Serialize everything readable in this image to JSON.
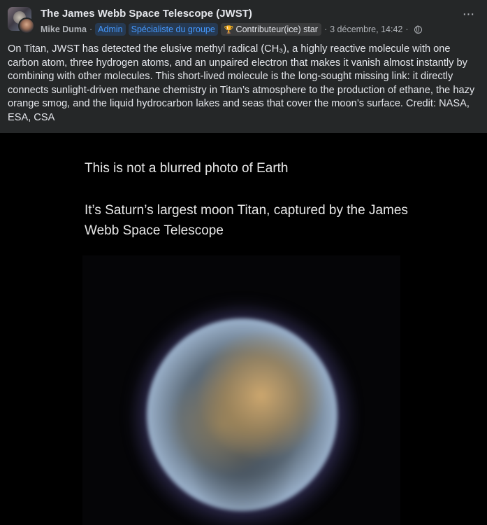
{
  "header": {
    "group_name": "The James Webb Space Telescope (JWST)",
    "author": "Mike Duma",
    "separator": "·",
    "badges": [
      "Admin",
      "Spécialiste du groupe"
    ],
    "contributor_badge": "Contributeur(ice) star",
    "trophy_icon": "🏆",
    "timestamp": "3 décembre, 14:42",
    "visibility_icon": "globe-icon",
    "more_label": "···"
  },
  "post": {
    "text": "On Titan, JWST has detected the elusive methyl radical (CH₃), a highly reactive molecule with one carbon atom, three hydrogen atoms, and an unpaired electron that makes it vanish almost instantly by combining with other molecules. This short-lived molecule is the long-sought missing link: it directly connects sunlight-driven methane chemistry in Titan’s atmosphere to the production of ethane, the hazy orange smog, and the liquid hydrocarbon lakes and seas that cover the moon’s surface. Credit: NASA, ESA, CSA"
  },
  "image": {
    "line1": "This is not a blurred photo of Earth",
    "line2": "It’s Saturn’s largest moon Titan, captured by the James Webb Space Telescope"
  },
  "colors": {
    "background": "#252728",
    "badge_blue_text": "#4599ff",
    "badge_blue_bg": "#263951",
    "text_primary": "#e4e6eb",
    "text_secondary": "#b0b3b8"
  }
}
